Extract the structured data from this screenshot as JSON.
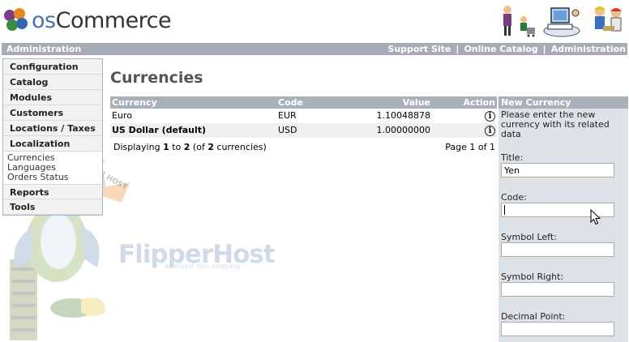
{
  "header": {
    "logo_prefix": "os",
    "logo_suffix": "Commerce"
  },
  "topbar": {
    "left": "Administration",
    "links": [
      "Support Site",
      "Online Catalog",
      "Administration"
    ],
    "separator": "|"
  },
  "menu": {
    "sections": [
      {
        "label": "Configuration"
      },
      {
        "label": "Catalog"
      },
      {
        "label": "Modules"
      },
      {
        "label": "Customers"
      },
      {
        "label": "Locations / Taxes"
      },
      {
        "label": "Localization",
        "items": [
          "Currencies",
          "Languages",
          "Orders Status"
        ]
      },
      {
        "label": "Reports"
      },
      {
        "label": "Tools"
      }
    ]
  },
  "watermark": {
    "brand": "FlipperHost",
    "tagline": "an invest tion company",
    "cap_text": "FLIPPER HOST"
  },
  "page": {
    "title": "Currencies"
  },
  "table": {
    "headers": {
      "currency": "Currency",
      "code": "Code",
      "value": "Value",
      "action": "Action"
    },
    "rows": [
      {
        "currency": "Euro",
        "code": "EUR",
        "value": "1.10048878",
        "action_icon": "info-icon"
      },
      {
        "currency": "US Dollar (default)",
        "code": "USD",
        "value": "1.00000000",
        "action_icon": "info-icon"
      }
    ],
    "footer": {
      "displaying_prefix": "Displaying",
      "from": "1",
      "to_word": "to",
      "to": "2",
      "of_prefix": "(of",
      "total": "2",
      "of_suffix": "currencies)",
      "pagination": "Page 1 of 1"
    }
  },
  "panel": {
    "title": "New Currency",
    "intro": "Please enter the new currency with its related data",
    "fields": [
      {
        "label": "Title:",
        "value": "Yen"
      },
      {
        "label": "Code:",
        "value": ""
      },
      {
        "label": "Symbol Left:",
        "value": ""
      },
      {
        "label": "Symbol Right:",
        "value": ""
      },
      {
        "label": "Decimal Point:",
        "value": ""
      }
    ]
  },
  "colors": {
    "bar": "#a9b0ba",
    "panel_bg": "#dde2e7",
    "logo_accent": "#4a6fb5",
    "watermark": "#cfdbe9"
  }
}
